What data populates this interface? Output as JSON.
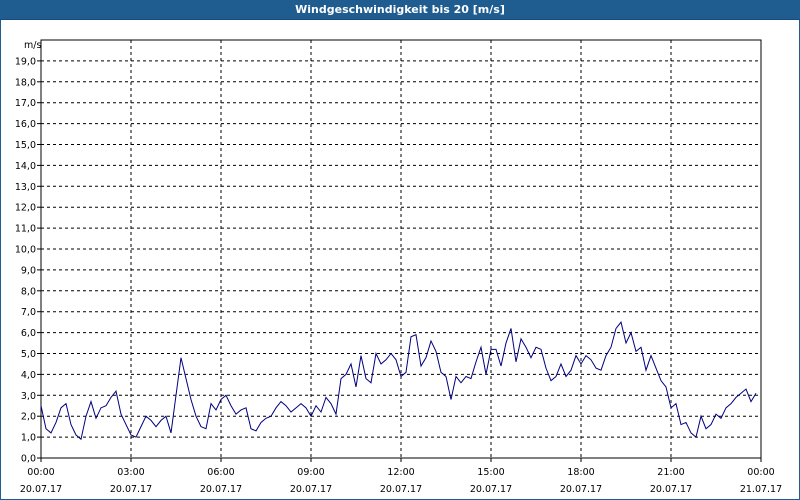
{
  "window": {
    "title": "Windgeschwindigkeit bis 20 [m/s]"
  },
  "colors": {
    "titlebar": "#1f5c8f",
    "line": "#00007f",
    "grid": "#000000"
  },
  "chart_data": {
    "type": "line",
    "title": "Windgeschwindigkeit bis 20 [m/s]",
    "ylabel": "m/s",
    "xlabel": "",
    "ylim": [
      0,
      20
    ],
    "y_ticks": [
      "0,0",
      "1,0",
      "2,0",
      "3,0",
      "4,0",
      "5,0",
      "6,0",
      "7,0",
      "8,0",
      "9,0",
      "10,0",
      "11,0",
      "12,0",
      "13,0",
      "14,0",
      "15,0",
      "16,0",
      "17,0",
      "18,0",
      "19,0"
    ],
    "x_ticks": [
      {
        "time": "00:00",
        "date": "20.07.17"
      },
      {
        "time": "03:00",
        "date": "20.07.17"
      },
      {
        "time": "06:00",
        "date": "20.07.17"
      },
      {
        "time": "09:00",
        "date": "20.07.17"
      },
      {
        "time": "12:00",
        "date": "20.07.17"
      },
      {
        "time": "15:00",
        "date": "20.07.17"
      },
      {
        "time": "18:00",
        "date": "20.07.17"
      },
      {
        "time": "21:00",
        "date": "20.07.17"
      },
      {
        "time": "00:00",
        "date": "21.07.17"
      }
    ],
    "grid": true,
    "series": [
      {
        "x": [
          "20.07.17 00:00",
          "20.07.17 00:10",
          "20.07.17 00:20",
          "20.07.17 00:30",
          "20.07.17 00:40",
          "20.07.17 00:50",
          "20.07.17 01:00",
          "20.07.17 01:10",
          "20.07.17 01:20",
          "20.07.17 01:30",
          "20.07.17 01:40",
          "20.07.17 01:50",
          "20.07.17 02:00",
          "20.07.17 02:10",
          "20.07.17 02:20",
          "20.07.17 02:30",
          "20.07.17 02:40",
          "20.07.17 02:50",
          "20.07.17 03:00",
          "20.07.17 03:10",
          "20.07.17 03:20",
          "20.07.17 03:30",
          "20.07.17 03:40",
          "20.07.17 03:50",
          "20.07.17 04:00",
          "20.07.17 04:10",
          "20.07.17 04:20",
          "20.07.17 04:30",
          "20.07.17 04:40",
          "20.07.17 04:50",
          "20.07.17 05:00",
          "20.07.17 05:10",
          "20.07.17 05:20",
          "20.07.17 05:30",
          "20.07.17 05:40",
          "20.07.17 05:50",
          "20.07.17 06:00",
          "20.07.17 06:10",
          "20.07.17 06:20",
          "20.07.17 06:30",
          "20.07.17 06:40",
          "20.07.17 06:50",
          "20.07.17 07:00",
          "20.07.17 07:10",
          "20.07.17 07:20",
          "20.07.17 07:30",
          "20.07.17 07:40",
          "20.07.17 07:50",
          "20.07.17 08:00",
          "20.07.17 08:10",
          "20.07.17 08:20",
          "20.07.17 08:30",
          "20.07.17 08:40",
          "20.07.17 08:50",
          "20.07.17 09:00",
          "20.07.17 09:10",
          "20.07.17 09:20",
          "20.07.17 09:30",
          "20.07.17 09:40",
          "20.07.17 09:50",
          "20.07.17 10:00",
          "20.07.17 10:10",
          "20.07.17 10:20",
          "20.07.17 10:30",
          "20.07.17 10:40",
          "20.07.17 10:50",
          "20.07.17 11:00",
          "20.07.17 11:10",
          "20.07.17 11:20",
          "20.07.17 11:30",
          "20.07.17 11:40",
          "20.07.17 11:50",
          "20.07.17 12:00",
          "20.07.17 12:10",
          "20.07.17 12:20",
          "20.07.17 12:30",
          "20.07.17 12:40",
          "20.07.17 12:50",
          "20.07.17 13:00",
          "20.07.17 13:10",
          "20.07.17 13:20",
          "20.07.17 13:30",
          "20.07.17 13:40",
          "20.07.17 13:50",
          "20.07.17 14:00",
          "20.07.17 14:10",
          "20.07.17 14:20",
          "20.07.17 14:30",
          "20.07.17 14:40",
          "20.07.17 14:50",
          "20.07.17 15:00",
          "20.07.17 15:10",
          "20.07.17 15:20",
          "20.07.17 15:30",
          "20.07.17 15:40",
          "20.07.17 15:50",
          "20.07.17 16:00",
          "20.07.17 16:10",
          "20.07.17 16:20",
          "20.07.17 16:30",
          "20.07.17 16:40",
          "20.07.17 16:50",
          "20.07.17 17:00",
          "20.07.17 17:10",
          "20.07.17 17:20",
          "20.07.17 17:30",
          "20.07.17 17:40",
          "20.07.17 17:50",
          "20.07.17 18:00",
          "20.07.17 18:10",
          "20.07.17 18:20",
          "20.07.17 18:30",
          "20.07.17 18:40",
          "20.07.17 18:50",
          "20.07.17 19:00",
          "20.07.17 19:10",
          "20.07.17 19:20",
          "20.07.17 19:30",
          "20.07.17 19:40",
          "20.07.17 19:50",
          "20.07.17 20:00",
          "20.07.17 20:10",
          "20.07.17 20:20",
          "20.07.17 20:30",
          "20.07.17 20:40",
          "20.07.17 20:50",
          "20.07.17 21:00",
          "20.07.17 21:10",
          "20.07.17 21:20",
          "20.07.17 21:30",
          "20.07.17 21:40",
          "20.07.17 21:50",
          "20.07.17 22:00",
          "20.07.17 22:10",
          "20.07.17 22:20",
          "20.07.17 22:30",
          "20.07.17 22:40",
          "20.07.17 22:50",
          "20.07.17 23:00",
          "20.07.17 23:10",
          "20.07.17 23:20",
          "20.07.17 23:30",
          "20.07.17 23:40",
          "20.07.17 23:50"
        ],
        "values": [
          2.5,
          1.4,
          1.2,
          1.7,
          2.4,
          2.6,
          1.6,
          1.1,
          0.9,
          2.0,
          2.7,
          1.9,
          2.4,
          2.5,
          2.9,
          3.2,
          2.1,
          1.6,
          1.1,
          1.0,
          1.5,
          2.0,
          1.8,
          1.5,
          1.8,
          2.0,
          1.2,
          3.0,
          4.8,
          3.8,
          2.8,
          2.0,
          1.5,
          1.4,
          2.6,
          2.3,
          2.8,
          3.0,
          2.5,
          2.1,
          2.3,
          2.4,
          1.4,
          1.3,
          1.7,
          1.9,
          2.0,
          2.4,
          2.7,
          2.5,
          2.2,
          2.4,
          2.6,
          2.4,
          2.0,
          2.5,
          2.2,
          2.9,
          2.6,
          2.1,
          3.8,
          4.0,
          4.5,
          3.4,
          4.9,
          3.8,
          3.6,
          5.0,
          4.5,
          4.7,
          5.0,
          4.7,
          3.9,
          4.1,
          5.8,
          5.9,
          4.4,
          4.8,
          5.6,
          5.1,
          4.1,
          3.9,
          2.8,
          3.9,
          3.6,
          3.9,
          3.8,
          4.6,
          5.3,
          4.0,
          5.2,
          5.2,
          4.4,
          5.5,
          6.2,
          4.6,
          5.7,
          5.3,
          4.8,
          5.3,
          5.2,
          4.3,
          3.7,
          3.9,
          4.5,
          3.9,
          4.2,
          4.9,
          4.5,
          4.9,
          4.7,
          4.3,
          4.2,
          4.9,
          5.3,
          6.2,
          6.5,
          5.5,
          6.0,
          5.1,
          5.3,
          4.2,
          4.9,
          4.3,
          3.7,
          3.4,
          2.4,
          2.6,
          1.6,
          1.7,
          1.2,
          1.0,
          2.0,
          1.4,
          1.6,
          2.1,
          1.9,
          2.4,
          2.6,
          2.9,
          3.1,
          3.3,
          2.7,
          3.1
        ]
      }
    ]
  }
}
